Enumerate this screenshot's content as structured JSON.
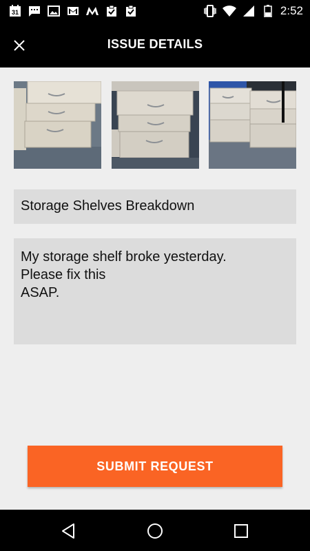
{
  "status_bar": {
    "time": "2:52",
    "calendar_day": "31",
    "icons_left": [
      "calendar-icon",
      "chat-icon",
      "image-icon",
      "gmail-icon",
      "m-icon",
      "clipboard-check-icon",
      "clipboard-check-icon"
    ],
    "icons_right": [
      "vibrate-icon",
      "wifi-icon",
      "signal-icon",
      "battery-icon"
    ]
  },
  "header": {
    "title": "ISSUE DETAILS",
    "close_icon": "close-icon"
  },
  "photos": {
    "count": 3
  },
  "form": {
    "title_value": "Storage Shelves Breakdown",
    "description_value": "My storage shelf broke yesterday.\nPlease fix this\nASAP."
  },
  "submit": {
    "label": "SUBMIT REQUEST",
    "color": "#fa6424"
  },
  "nav": {
    "icons": [
      "back-icon",
      "home-icon",
      "recents-icon"
    ]
  },
  "colors": {
    "bar_background": "#000000",
    "page_background": "#eeeeee",
    "field_background": "#dcdcdc"
  }
}
